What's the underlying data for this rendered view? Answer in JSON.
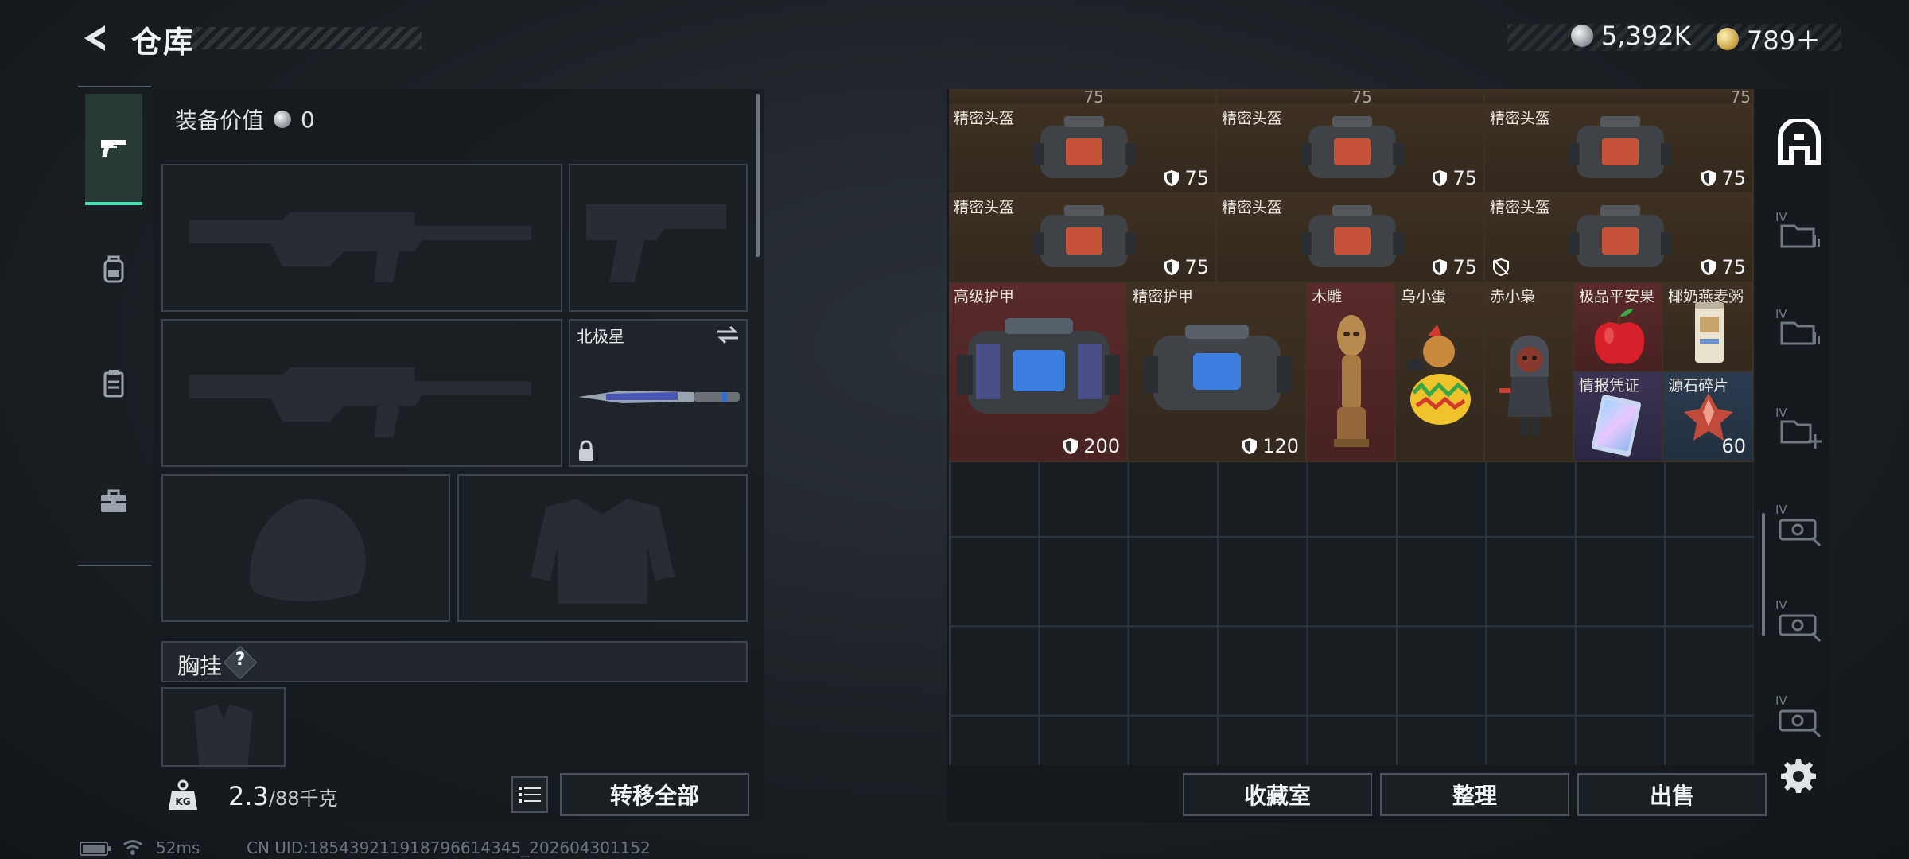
{
  "header": {
    "title": "仓库",
    "currency_silver": "5,392K",
    "currency_gold": "789＋"
  },
  "left_tabs": [
    {
      "name": "weapons",
      "icon": "pistol-icon",
      "active": true
    },
    {
      "name": "backpack",
      "icon": "backpack-icon",
      "active": false
    },
    {
      "name": "vest",
      "icon": "vest-icon",
      "active": false
    },
    {
      "name": "toolbox",
      "icon": "briefcase-icon",
      "active": false
    }
  ],
  "equipment": {
    "value_label": "装备价值",
    "value": "0",
    "melee_slot_label": "北极星",
    "chest_rig_label": "胸挂",
    "help_glyph": "?"
  },
  "bottom_left": {
    "weight_current": "2.3",
    "weight_capacity": "/88千克",
    "transfer_all": "转移全部"
  },
  "stash": {
    "top_partial_durability": "75",
    "items": [
      {
        "name": "精密头盔",
        "durability": "75"
      },
      {
        "name": "精密头盔",
        "durability": "75"
      },
      {
        "name": "精密头盔",
        "durability": "75"
      },
      {
        "name": "精密头盔",
        "durability": "75"
      },
      {
        "name": "精密头盔",
        "durability": "75"
      },
      {
        "name": "精密头盔",
        "durability": "75"
      },
      {
        "name": "高级护甲",
        "durability": "200"
      },
      {
        "name": "精密护甲",
        "durability": "120"
      },
      {
        "name": "木雕",
        "durability": ""
      },
      {
        "name": "乌小蛋",
        "durability": ""
      },
      {
        "name": "赤小枭",
        "durability": ""
      },
      {
        "name": "极品平安果",
        "durability": ""
      },
      {
        "name": "椰奶燕麦粥",
        "durability": ""
      },
      {
        "name": "情报凭证",
        "durability": ""
      },
      {
        "name": "源石碎片",
        "durability": "60"
      }
    ]
  },
  "stash_buttons": {
    "collection": "收藏室",
    "sort": "整理",
    "sell": "出售"
  },
  "right_rail": {
    "tab_prefix": "IV"
  },
  "status_bar": {
    "ping": "52ms",
    "uid": "CN UID:185439211918796614345_202604301152"
  },
  "colors": {
    "accent": "#49e2b6",
    "item_brown": "#3f3124",
    "item_red": "#5a2a2c",
    "item_purple": "#3b3352",
    "item_blue": "#2c3c4f"
  }
}
